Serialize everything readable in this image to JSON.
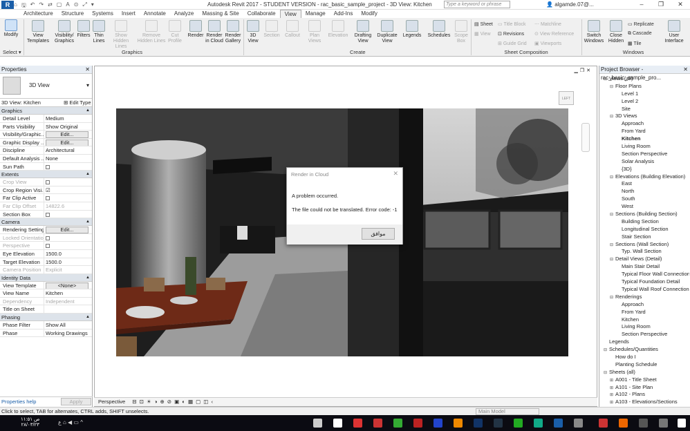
{
  "titlebar": {
    "title": "Autodesk Revit 2017 -  STUDENT VERSION -     rac_basic_sample_project - 3D View: Kitchen",
    "search_placeholder": "Type a keyword or phrase",
    "user": "algamde.07@...",
    "app_label": "R"
  },
  "qat": [
    "⌂",
    "🖫",
    "↶",
    "↷",
    "⇄",
    "▢",
    "A",
    "⊙",
    "⤢",
    "▾"
  ],
  "tabs": [
    {
      "label": "Architecture",
      "active": false
    },
    {
      "label": "Structure",
      "active": false
    },
    {
      "label": "Systems",
      "active": false
    },
    {
      "label": "Insert",
      "active": false
    },
    {
      "label": "Annotate",
      "active": false
    },
    {
      "label": "Analyze",
      "active": false
    },
    {
      "label": "Massing & Site",
      "active": false
    },
    {
      "label": "Collaborate",
      "active": false
    },
    {
      "label": "View",
      "active": true
    },
    {
      "label": "Manage",
      "active": false
    },
    {
      "label": "Add-Ins",
      "active": false
    },
    {
      "label": "Modify",
      "active": false
    }
  ],
  "ribbon": {
    "modify": "Modify",
    "view_templates": "View Templates",
    "vis_graphics": "Visibility/ Graphics",
    "filters": "Filters",
    "thin_lines": "Thin Lines",
    "show_hidden": "Show Hidden Lines",
    "remove_hidden": "Remove Hidden Lines",
    "cut_profile": "Cut Profile",
    "render": "Render",
    "render_cloud": "Render in Cloud",
    "render_gallery": "Render Gallery",
    "view3d": "3D View",
    "section": "Section",
    "callout": "Callout",
    "plan_views": "Plan Views",
    "elevation": "Elevation",
    "drafting_view": "Drafting View",
    "duplicate_view": "Duplicate View",
    "legends": "Legends",
    "schedules": "Schedules",
    "scope_box": "Scope Box",
    "sheet": "Sheet",
    "view": "View",
    "title_block": "Title Block",
    "revisions": "Revisions",
    "guide_grid": "Guide Grid",
    "matchline": "Matchline",
    "view_reference": "View Reference",
    "viewports": "Viewports",
    "switch_windows": "Switch Windows",
    "close_hidden": "Close Hidden",
    "replicate": "Replicate",
    "cascade": "Cascade",
    "tile": "Tile",
    "user_interface": "User Interface",
    "panel_select": "Select ▾",
    "panel_graphics": "Graphics",
    "panel_create": "Create",
    "panel_sheet": "Sheet Composition",
    "panel_windows": "Windows"
  },
  "properties": {
    "header": "Properties",
    "type_name": "3D View",
    "selector": "3D View: Kitchen",
    "edit_type": "Edit Type",
    "groups": [
      {
        "name": "Graphics",
        "rows": [
          {
            "k": "Detail Level",
            "v": "Medium"
          },
          {
            "k": "Parts Visibility",
            "v": "Show Original"
          },
          {
            "k": "Visibility/Graphic...",
            "v": "Edit...",
            "btn": true
          },
          {
            "k": "Graphic Display ...",
            "v": "Edit...",
            "btn": true
          },
          {
            "k": "Discipline",
            "v": "Architectural"
          },
          {
            "k": "Default Analysis ...",
            "v": "None"
          },
          {
            "k": "Sun Path",
            "v": "",
            "chk": true
          }
        ]
      },
      {
        "name": "Extents",
        "rows": [
          {
            "k": "Crop View",
            "v": "",
            "chk": true,
            "dis": true
          },
          {
            "k": "Crop Region Visi...",
            "v": "☑",
            "chk": false
          },
          {
            "k": "Far Clip Active",
            "v": "",
            "chk": true
          },
          {
            "k": "Far Clip Offset",
            "v": "14822.6",
            "dis": true
          },
          {
            "k": "Section Box",
            "v": "",
            "chk": true
          }
        ]
      },
      {
        "name": "Camera",
        "rows": [
          {
            "k": "Rendering Settings",
            "v": "Edit...",
            "btn": true
          },
          {
            "k": "Locked Orientation",
            "v": "",
            "chk": true,
            "dis": true
          },
          {
            "k": "Perspective",
            "v": "",
            "chk": true,
            "dis": true
          },
          {
            "k": "Eye Elevation",
            "v": "1500.0"
          },
          {
            "k": "Target Elevation",
            "v": "1500.0"
          },
          {
            "k": "Camera Position",
            "v": "Explicit",
            "dis": true
          }
        ]
      },
      {
        "name": "Identity Data",
        "rows": [
          {
            "k": "View Template",
            "v": "<None>",
            "btn": true
          },
          {
            "k": "View Name",
            "v": "Kitchen"
          },
          {
            "k": "Dependency",
            "v": "Independent",
            "dis": true
          },
          {
            "k": "Title on Sheet",
            "v": ""
          }
        ]
      },
      {
        "name": "Phasing",
        "rows": [
          {
            "k": "Phase Filter",
            "v": "Show All"
          },
          {
            "k": "Phase",
            "v": "Working Drawings"
          }
        ]
      }
    ],
    "help": "Properties help",
    "apply": "Apply"
  },
  "viewcube": "LEFT",
  "dialog": {
    "title": "Render in Cloud",
    "message1": "A problem occurred.",
    "message2": "The file could not be translated. Error code: -1",
    "ok": "موافق"
  },
  "viewbar": {
    "label": "Perspective",
    "icons": "⊟ ⊡ ☀ ◑ ⊕ ⊘ ▣ ◐ ▦ ▢ ◫ ‹"
  },
  "browser": {
    "header": "Project Browser - rac_basic_sample_pro...",
    "items": [
      {
        "t": "Views (all)",
        "lvl": 0,
        "tog": "⊟"
      },
      {
        "t": "Floor Plans",
        "lvl": 1,
        "tog": "⊟"
      },
      {
        "t": "Level 1",
        "lvl": 2
      },
      {
        "t": "Level 2",
        "lvl": 2
      },
      {
        "t": "Site",
        "lvl": 2
      },
      {
        "t": "3D Views",
        "lvl": 1,
        "tog": "⊟"
      },
      {
        "t": "Approach",
        "lvl": 2
      },
      {
        "t": "From Yard",
        "lvl": 2
      },
      {
        "t": "Kitchen",
        "lvl": 2,
        "sel": true
      },
      {
        "t": "Living Room",
        "lvl": 2
      },
      {
        "t": "Section Perspective",
        "lvl": 2
      },
      {
        "t": "Solar Analysis",
        "lvl": 2
      },
      {
        "t": "{3D}",
        "lvl": 2
      },
      {
        "t": "Elevations (Building Elevation)",
        "lvl": 1,
        "tog": "⊟"
      },
      {
        "t": "East",
        "lvl": 2
      },
      {
        "t": "North",
        "lvl": 2
      },
      {
        "t": "South",
        "lvl": 2
      },
      {
        "t": "West",
        "lvl": 2
      },
      {
        "t": "Sections (Building Section)",
        "lvl": 1,
        "tog": "⊟"
      },
      {
        "t": "Building Section",
        "lvl": 2
      },
      {
        "t": "Longitudinal Section",
        "lvl": 2
      },
      {
        "t": "Stair Section",
        "lvl": 2
      },
      {
        "t": "Sections (Wall Section)",
        "lvl": 1,
        "tog": "⊟"
      },
      {
        "t": "Typ. Wall Section",
        "lvl": 2
      },
      {
        "t": "Detail Views (Detail)",
        "lvl": 1,
        "tog": "⊟"
      },
      {
        "t": "Main Stair Detail",
        "lvl": 2
      },
      {
        "t": "Typical Floor Wall Connection",
        "lvl": 2
      },
      {
        "t": "Typical Foundation Detail",
        "lvl": 2
      },
      {
        "t": "Typical Wall Roof Connection",
        "lvl": 2
      },
      {
        "t": "Renderings",
        "lvl": 1,
        "tog": "⊟"
      },
      {
        "t": "Approach",
        "lvl": 2
      },
      {
        "t": "From Yard",
        "lvl": 2
      },
      {
        "t": "Kitchen",
        "lvl": 2
      },
      {
        "t": "Living Room",
        "lvl": 2
      },
      {
        "t": "Section Perspective",
        "lvl": 2
      },
      {
        "t": "Legends",
        "lvl": 0,
        "tog": ""
      },
      {
        "t": "Schedules/Quantities",
        "lvl": 0,
        "tog": "⊟"
      },
      {
        "t": "How do I",
        "lvl": 1
      },
      {
        "t": "Planting Schedule",
        "lvl": 1
      },
      {
        "t": "Sheets (all)",
        "lvl": 0,
        "tog": "⊟"
      },
      {
        "t": "A001 - Title Sheet",
        "lvl": 1,
        "tog": "⊞"
      },
      {
        "t": "A101 - Site Plan",
        "lvl": 1,
        "tog": "⊞"
      },
      {
        "t": "A102 - Plans",
        "lvl": 1,
        "tog": "⊞"
      },
      {
        "t": "A103 - Elevations/Sections",
        "lvl": 1,
        "tog": "⊞"
      }
    ]
  },
  "status": {
    "text": "Click to select, TAB for alternates, CTRL adds, SHIFT unselects.",
    "model": "Main Model"
  },
  "taskbar": {
    "time": "۱۱:۵۱ ص",
    "date": "۲۸/۰۳/۲۳",
    "sys": "ع ⌂ ◀ ▭ ^"
  }
}
